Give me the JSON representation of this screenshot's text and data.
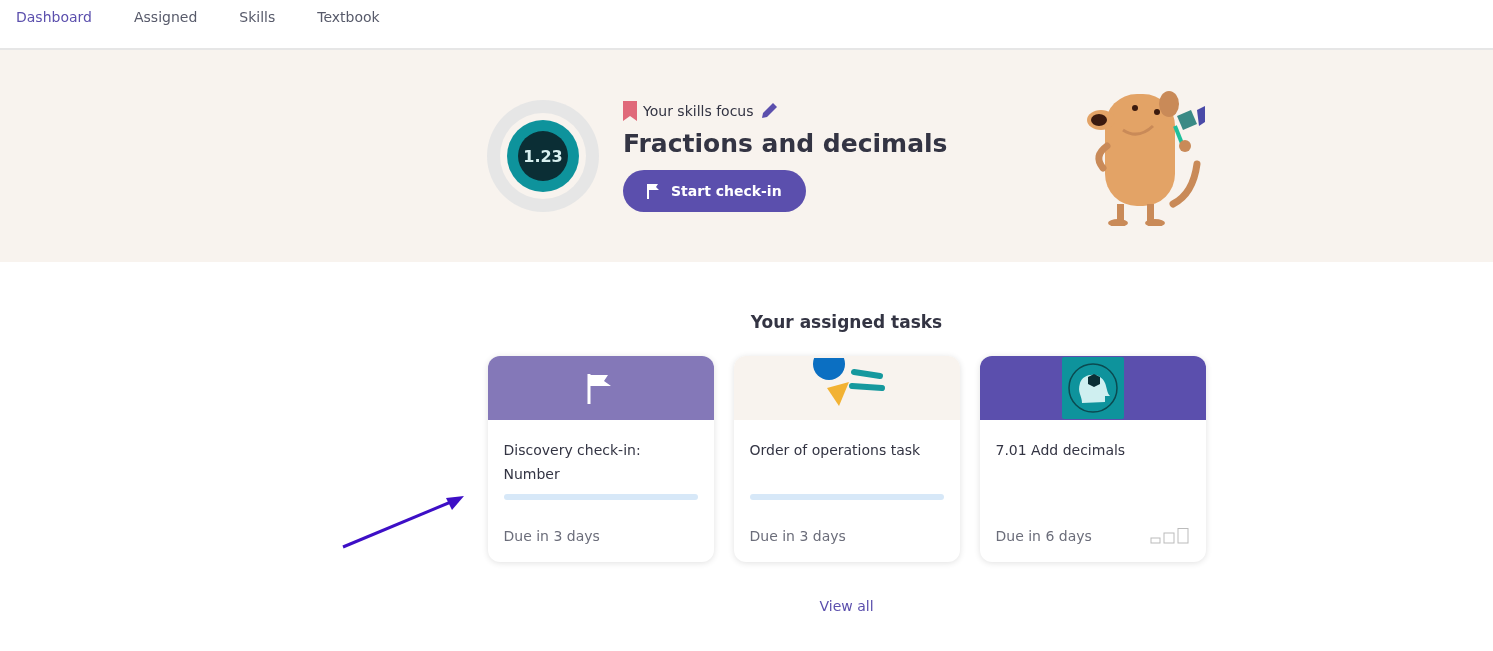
{
  "nav": {
    "tabs": [
      {
        "label": "Dashboard",
        "selected": true
      },
      {
        "label": "Assigned",
        "selected": false
      },
      {
        "label": "Skills",
        "selected": false
      },
      {
        "label": "Textbook",
        "selected": false
      }
    ]
  },
  "focus": {
    "badge": "1.23",
    "eyebrow": "Your skills focus",
    "title": "Fractions and decimals",
    "button": "Start check-in"
  },
  "tasks": {
    "heading": "Your assigned tasks",
    "cards": [
      {
        "kind": "checkin",
        "title": "Discovery check-in: Number",
        "level": 0,
        "due": "Due in 3 days"
      },
      {
        "kind": "operations",
        "title": "Order of operations task",
        "level": 0,
        "due": "Due in 3 days"
      },
      {
        "kind": "lesson",
        "title": "7.01 Add decimals",
        "due": "Due in 6 days"
      }
    ],
    "view_all": "View all"
  }
}
